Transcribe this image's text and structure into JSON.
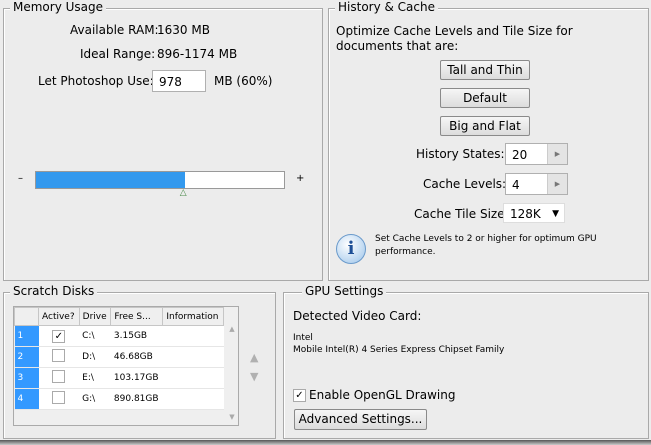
{
  "memory": {
    "title": "Memory Usage",
    "available_label": "Available RAM:",
    "available_value": "1630 MB",
    "ideal_label": "Ideal Range:",
    "ideal_value": "896-1174 MB",
    "let_label": "Let Photoshop Use:",
    "let_value": "978",
    "let_unit": "MB (60%)",
    "slider_percent": 60,
    "minus": "–",
    "plus": "+"
  },
  "history": {
    "title": "History & Cache",
    "desc": "Optimize Cache Levels and Tile Size for documents that are:",
    "btn_tall": "Tall and Thin",
    "btn_default": "Default",
    "btn_big": "Big and Flat",
    "history_label": "History States:",
    "history_value": "20",
    "levels_label": "Cache Levels:",
    "levels_value": "4",
    "tile_label": "Cache Tile Size:",
    "tile_value": "128K",
    "info": "Set Cache Levels to 2 or higher for optimum GPU performance."
  },
  "scratch": {
    "title": "Scratch Disks",
    "columns": [
      "Active?",
      "Drive",
      "Free S...",
      "Information"
    ],
    "rows": [
      {
        "n": "1",
        "active": true,
        "drive": "C:\\",
        "free": "3.15GB",
        "info": ""
      },
      {
        "n": "2",
        "active": false,
        "drive": "D:\\",
        "free": "46.68GB",
        "info": ""
      },
      {
        "n": "3",
        "active": false,
        "drive": "E:\\",
        "free": "103.17GB",
        "info": ""
      },
      {
        "n": "4",
        "active": false,
        "drive": "G:\\",
        "free": "890.81GB",
        "info": ""
      }
    ]
  },
  "gpu": {
    "title": "GPU Settings",
    "detected_label": "Detected Video Card:",
    "vendor": "Intel",
    "card": "Mobile Intel(R) 4 Series Express Chipset Family",
    "opengl_label": "Enable OpenGL Drawing",
    "opengl_checked": true,
    "advanced": "Advanced Settings..."
  }
}
